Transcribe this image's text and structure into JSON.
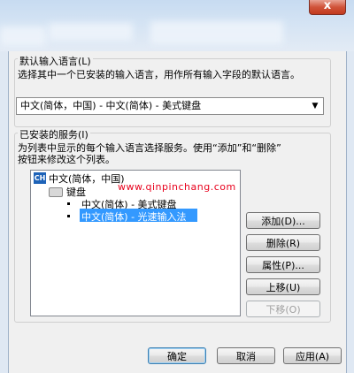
{
  "titlebar": {
    "close_label": "x"
  },
  "default_language": {
    "group_label": "默认输入语言(L)",
    "description": "选择其中一个已安装的输入语言，用作所有输入字段的默认语言。",
    "selected": "中文(简体，中国) - 中文(简体) - 美式键盘"
  },
  "installed_services": {
    "group_label": "已安装的服务(I)",
    "description_line1": "为列表中显示的每个输入语言选择服务。使用“添加”和“删除”",
    "description_line2": "按钮来修改这个列表。",
    "tree": {
      "language_badge": "CH",
      "language": "中文(简体，中国)",
      "category": "键盘",
      "items": [
        "中文(简体) - 美式键盘",
        "中文(简体) - 光速输入法"
      ]
    },
    "watermark": "www.qinpinchang.com",
    "buttons": {
      "add": "添加(D)...",
      "remove": "删除(R)",
      "properties": "属性(P)...",
      "move_up": "上移(U)",
      "move_down": "下移(O)"
    }
  },
  "footer": {
    "ok": "确定",
    "cancel": "取消",
    "apply": "应用(A)"
  },
  "colors": {
    "selection": "#3399ff",
    "watermark": "#e8001c"
  }
}
